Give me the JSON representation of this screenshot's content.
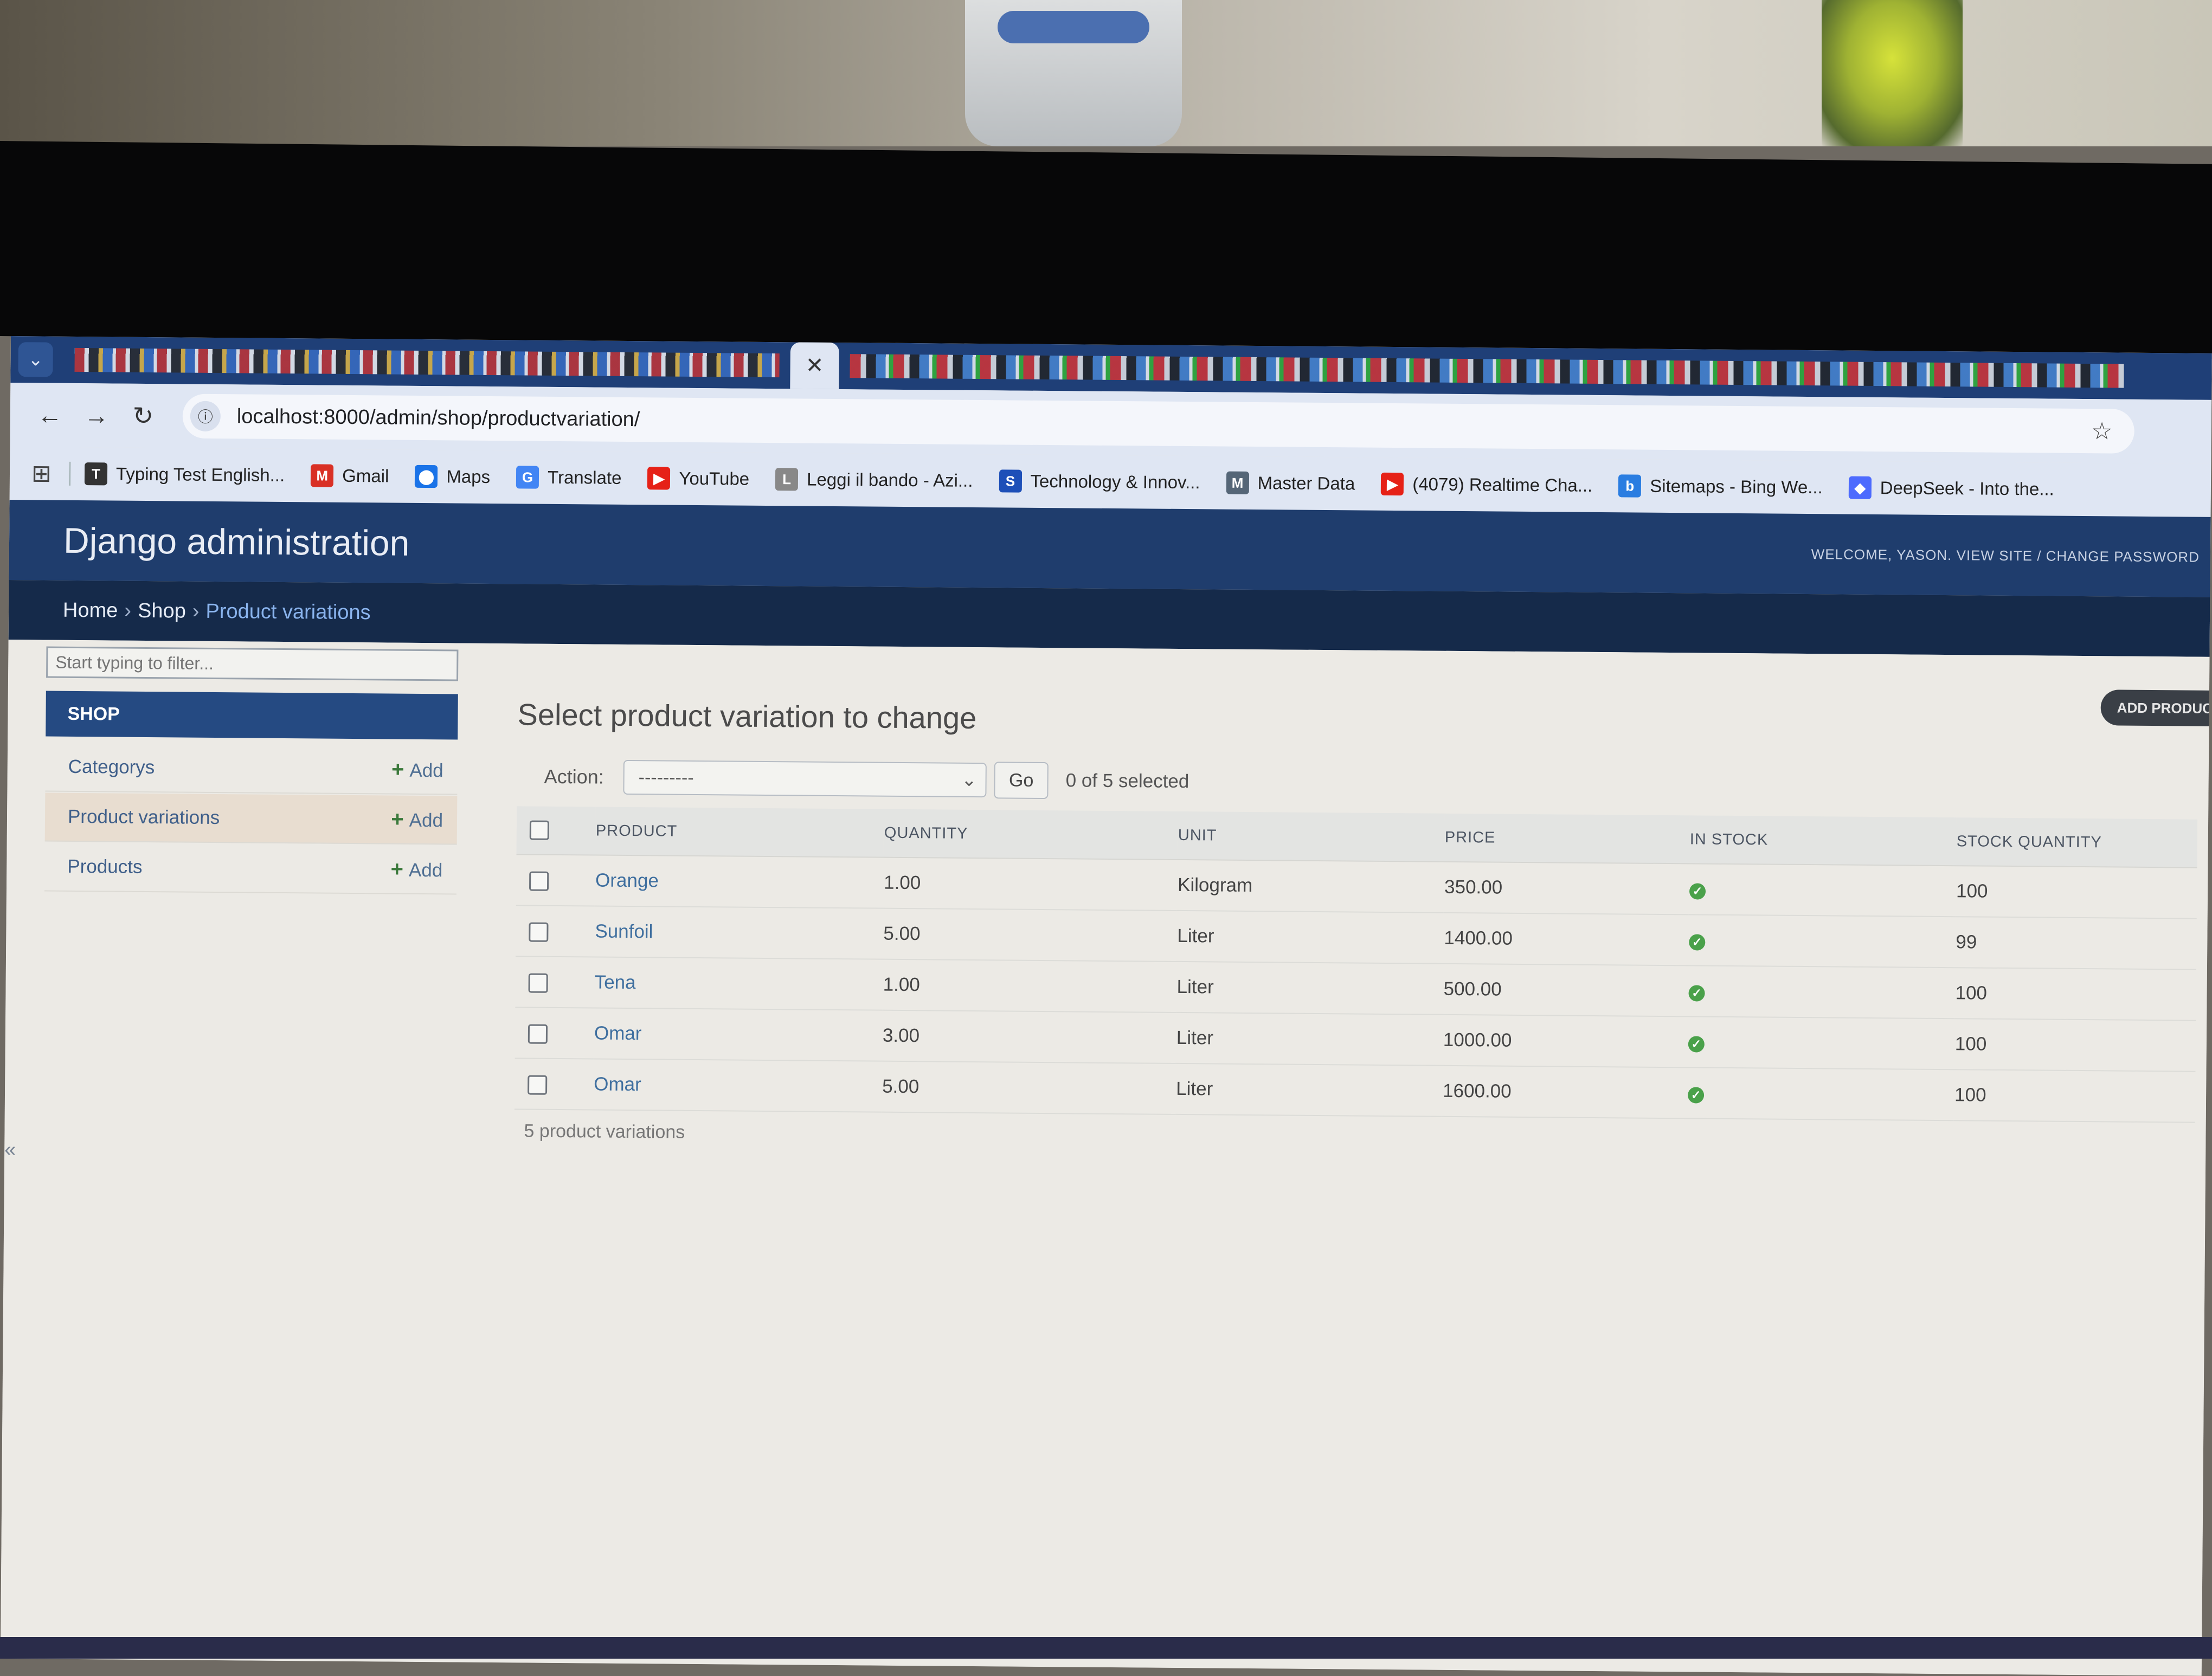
{
  "browser": {
    "active_tab_close": "✕",
    "url": "localhost:8000/admin/shop/productvariation/",
    "bookmarks": [
      {
        "label": "Typing Test English...",
        "icon_color": "#333333",
        "icon": "T"
      },
      {
        "label": "Gmail",
        "icon_color": "#d93025",
        "icon": "M"
      },
      {
        "label": "Maps",
        "icon_color": "#1a73e8",
        "icon": "⬤"
      },
      {
        "label": "Translate",
        "icon_color": "#4285f4",
        "icon": "G"
      },
      {
        "label": "YouTube",
        "icon_color": "#e62117",
        "icon": "▶"
      },
      {
        "label": "Leggi il bando - Azi...",
        "icon_color": "#888888",
        "icon": "L"
      },
      {
        "label": "Technology & Innov...",
        "icon_color": "#1d4fb8",
        "icon": "S"
      },
      {
        "label": "Master Data",
        "icon_color": "#556677",
        "icon": "M"
      },
      {
        "label": "(4079) Realtime Cha...",
        "icon_color": "#e62117",
        "icon": "▶"
      },
      {
        "label": "Sitemaps - Bing We...",
        "icon_color": "#2a7de1",
        "icon": "b"
      },
      {
        "label": "DeepSeek - Into the...",
        "icon_color": "#4d6bfe",
        "icon": "◆"
      }
    ]
  },
  "header": {
    "brand": "Django administration",
    "user_tools": "WELCOME, YASON. VIEW SITE / CHANGE PASSWORD"
  },
  "breadcrumbs": {
    "home": "Home",
    "app": "Shop",
    "current": "Product variations"
  },
  "sidebar": {
    "filter_placeholder": "Start typing to filter...",
    "module": "SHOP",
    "add_label": "Add",
    "models": [
      {
        "name": "Categorys"
      },
      {
        "name": "Product variations"
      },
      {
        "name": "Products"
      }
    ],
    "collapse": "«"
  },
  "main": {
    "title": "Select product variation to change",
    "add_button": "ADD PRODUCT VARIATION +",
    "action_label": "Action:",
    "action_value": "---------",
    "go": "Go",
    "counter": "0 of 5 selected",
    "columns": [
      "PRODUCT",
      "QUANTITY",
      "UNIT",
      "PRICE",
      "IN STOCK",
      "STOCK QUANTITY"
    ],
    "rows": [
      {
        "product": "Orange",
        "quantity": "1.00",
        "unit": "Kilogram",
        "price": "350.00",
        "in_stock": true,
        "stock_quantity": "100"
      },
      {
        "product": "Sunfoil",
        "quantity": "5.00",
        "unit": "Liter",
        "price": "1400.00",
        "in_stock": true,
        "stock_quantity": "99"
      },
      {
        "product": "Tena",
        "quantity": "1.00",
        "unit": "Liter",
        "price": "500.00",
        "in_stock": true,
        "stock_quantity": "100"
      },
      {
        "product": "Omar",
        "quantity": "3.00",
        "unit": "Liter",
        "price": "1000.00",
        "in_stock": true,
        "stock_quantity": "100"
      },
      {
        "product": "Omar",
        "quantity": "5.00",
        "unit": "Liter",
        "price": "1600.00",
        "in_stock": true,
        "stock_quantity": "100"
      }
    ],
    "result_count": "5 product variations"
  }
}
